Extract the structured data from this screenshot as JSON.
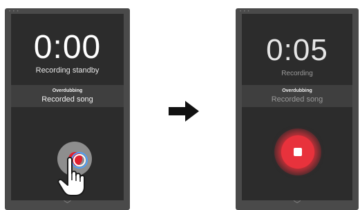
{
  "before": {
    "timer": "0:00",
    "status": "Recording standby",
    "mode_label": "Overdubbing",
    "song_title": "Recorded song",
    "chevron_icon": "chevron-down-icon",
    "action_icon": "record-icon"
  },
  "after": {
    "timer": "0:05",
    "status": "Recording",
    "mode_label": "Overdubbing",
    "song_title": "Recorded song",
    "chevron_icon": "chevron-down-icon",
    "action_icon": "stop-icon"
  },
  "transition_icon": "right-arrow-icon",
  "colors": {
    "device_frame": "#4a4a4a",
    "screen_bg": "#2c2c2c",
    "band_bg": "#3f3f3f",
    "record_red": "#e8323c",
    "touch_ring": "#4aa0ff"
  }
}
